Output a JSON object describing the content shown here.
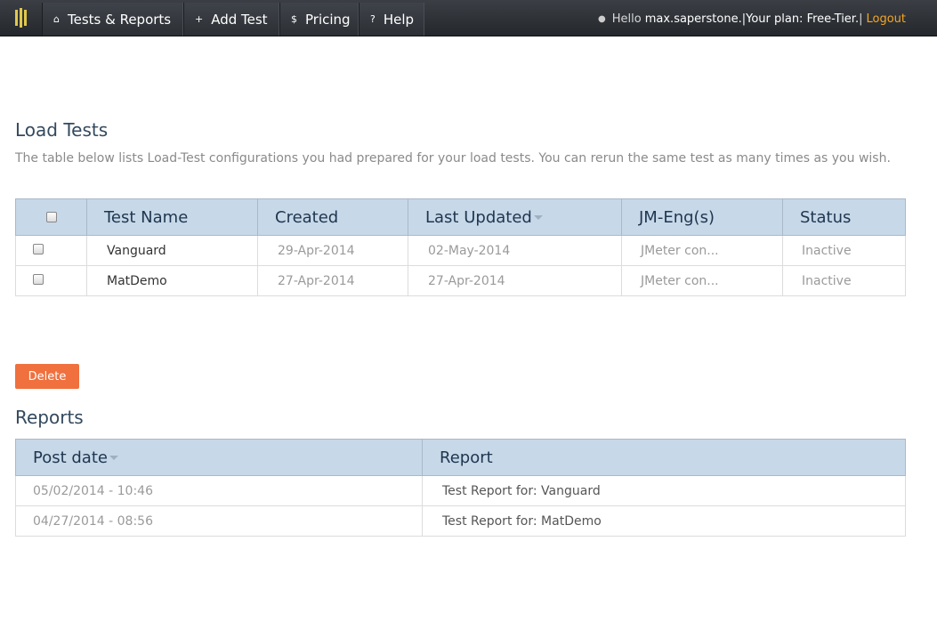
{
  "nav": {
    "items": [
      {
        "label": "Tests & Reports",
        "icon": "home-icon",
        "glyph": "⌂"
      },
      {
        "label": "Add Test",
        "icon": "plus-icon",
        "glyph": "+"
      },
      {
        "label": "Pricing",
        "icon": "dollar-icon",
        "glyph": "$"
      },
      {
        "label": "Help",
        "icon": "question-icon",
        "glyph": "?"
      }
    ],
    "user": {
      "greeting": "Hello",
      "username": "max.saperstone.",
      "plan": "|Your plan: Free-Tier.",
      "separator": "|",
      "logout": "Logout"
    }
  },
  "load_tests": {
    "title": "Load Tests",
    "description": "The table below lists Load-Test configurations you had prepared for your load tests. You can rerun the same test as many times as you wish.",
    "columns": [
      "Test Name",
      "Created",
      "Last Updated",
      "JM-Eng(s)",
      "Status"
    ],
    "rows": [
      {
        "name": "Vanguard",
        "created": "29-Apr-2014",
        "updated": "02-May-2014",
        "engines": "JMeter con...",
        "status": "Inactive"
      },
      {
        "name": "MatDemo",
        "created": "27-Apr-2014",
        "updated": "27-Apr-2014",
        "engines": "JMeter con...",
        "status": "Inactive"
      }
    ],
    "delete_label": "Delete"
  },
  "reports": {
    "title": "Reports",
    "columns": [
      "Post date",
      "Report"
    ],
    "rows": [
      {
        "date": "05/02/2014 - 10:46",
        "report": "Test Report for: Vanguard"
      },
      {
        "date": "04/27/2014 - 08:56",
        "report": "Test Report for: MatDemo"
      }
    ]
  },
  "colors": {
    "accent": "#f0703e",
    "header_bg": "#c7d8e8",
    "nav_bg": "#2c2f34",
    "logout": "#f5a623"
  }
}
